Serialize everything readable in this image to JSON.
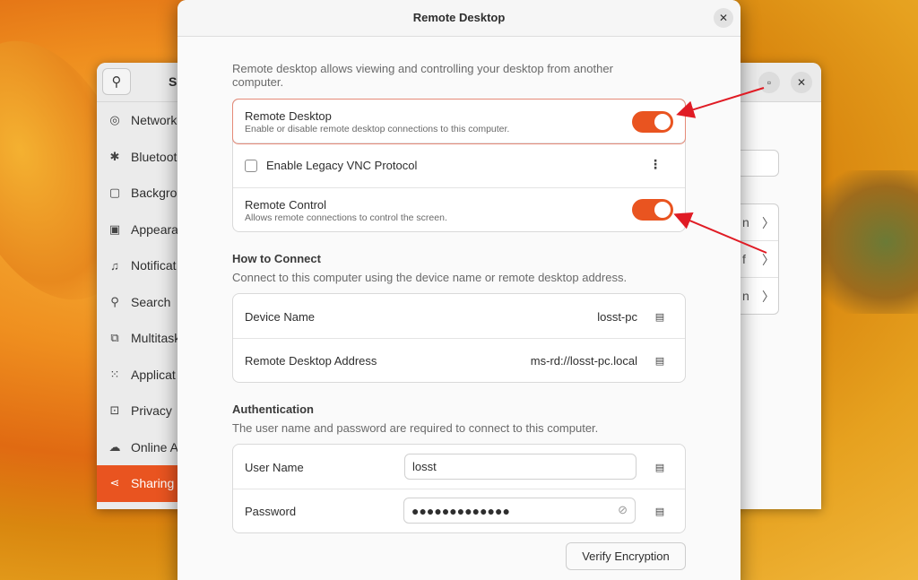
{
  "settings_window": {
    "title": "S",
    "sidebar": [
      {
        "icon": "network-icon",
        "glyph": "◎",
        "label": "Network"
      },
      {
        "icon": "bluetooth-icon",
        "glyph": "✱",
        "label": "Bluetoot"
      },
      {
        "icon": "background-icon",
        "glyph": "▢",
        "label": "Backgrou"
      },
      {
        "icon": "appearance-icon",
        "glyph": "▣",
        "label": "Appeara"
      },
      {
        "icon": "bell-icon",
        "glyph": "♫",
        "label": "Notificat"
      },
      {
        "icon": "search-icon",
        "glyph": "⚲",
        "label": "Search"
      },
      {
        "icon": "multitasking-icon",
        "glyph": "⧉",
        "label": "Multitask"
      },
      {
        "icon": "apps-grid-icon",
        "glyph": "⁙",
        "label": "Applicat"
      },
      {
        "icon": "lock-icon",
        "glyph": "⊡",
        "label": "Privacy"
      },
      {
        "icon": "cloud-icon",
        "glyph": "☁",
        "label": "Online A"
      },
      {
        "icon": "share-icon",
        "glyph": "⋖",
        "label": "Sharing"
      }
    ],
    "content_stubs": [
      "n",
      "f",
      "n"
    ]
  },
  "dialog": {
    "title": "Remote Desktop",
    "intro": "Remote desktop allows viewing and controlling your desktop from another computer.",
    "remote_desktop": {
      "title": "Remote Desktop",
      "subtitle": "Enable or disable remote desktop connections to this computer.",
      "enabled": true
    },
    "legacy_vnc": {
      "label": "Enable Legacy VNC Protocol",
      "checked": false
    },
    "remote_control": {
      "title": "Remote Control",
      "subtitle": "Allows remote connections to control the screen.",
      "enabled": true
    },
    "how_to_connect": {
      "title": "How to Connect",
      "description": "Connect to this computer using the device name or remote desktop address.",
      "device_name_label": "Device Name",
      "device_name_value": "losst-pc",
      "address_label": "Remote Desktop Address",
      "address_value": "ms-rd://losst-pc.local"
    },
    "authentication": {
      "title": "Authentication",
      "description": "The user name and password are required to connect to this computer.",
      "username_label": "User Name",
      "username_value": "losst",
      "password_label": "Password",
      "password_value": "●●●●●●●●●●●●●"
    },
    "verify_button": "Verify Encryption"
  },
  "colors": {
    "accent": "#e95420",
    "annotation": "#e01b24"
  }
}
